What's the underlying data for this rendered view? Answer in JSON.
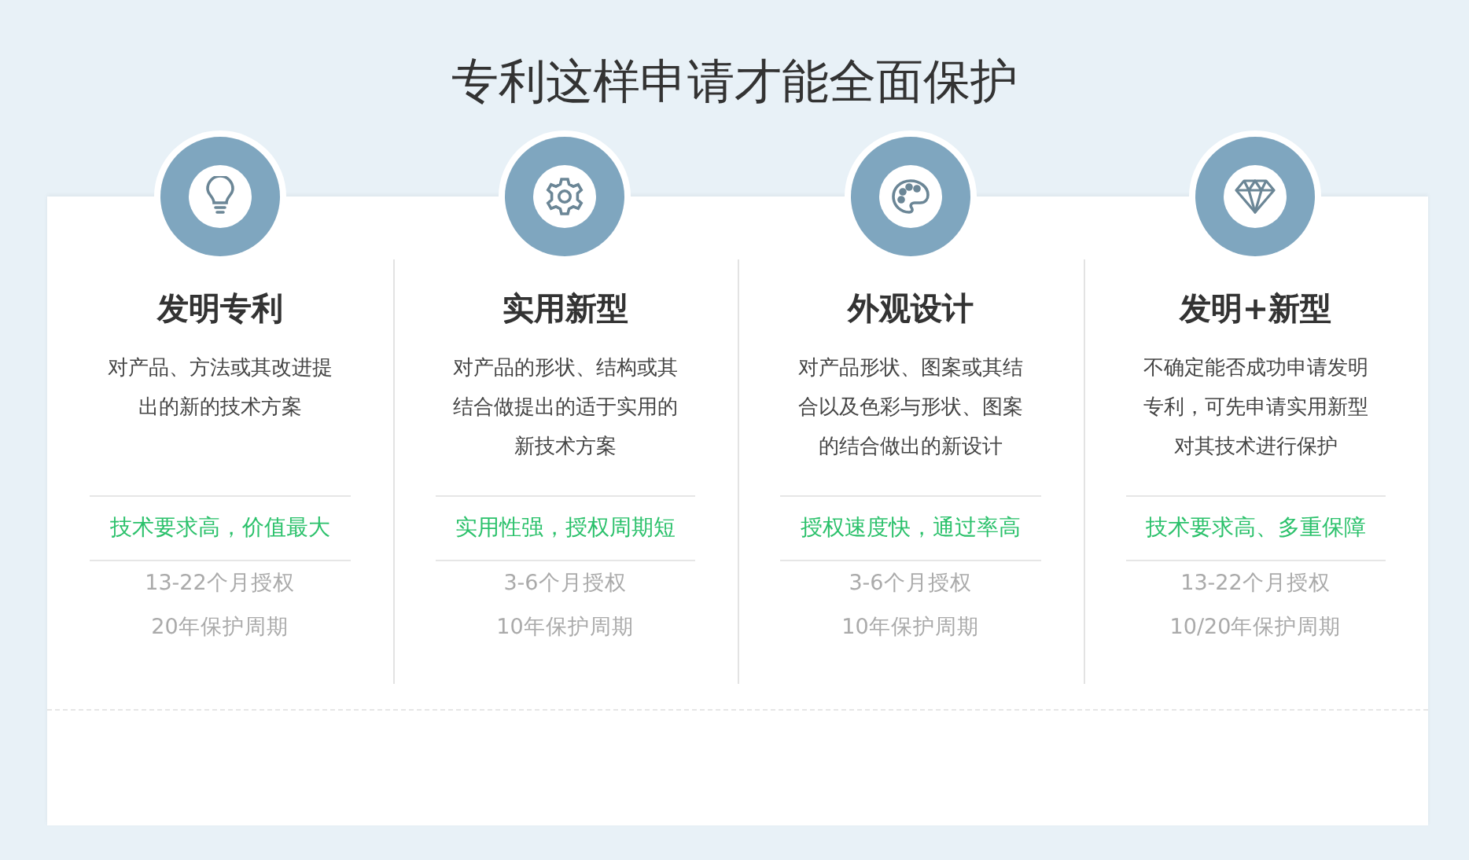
{
  "title": "专利这样申请才能全面保护",
  "plans": [
    {
      "name": "发明专利",
      "description": "对产品、方法或其改进提出的新的技术方案",
      "highlight": "技术要求高，价值最大",
      "grant_time": "13-22个月授权",
      "protection": "20年保护周期"
    },
    {
      "name": "实用新型",
      "description": "对产品的形状、结构或其结合做提出的适于实用的新技术方案",
      "highlight": "实用性强，授权周期短",
      "grant_time": "3-6个月授权",
      "protection": "10年保护周期"
    },
    {
      "name": "外观设计",
      "description": "对产品形状、图案或其结合以及色彩与形状、图案的结合做出的新设计",
      "highlight": "授权速度快，通过率高",
      "grant_time": "3-6个月授权",
      "protection": "10年保护周期"
    },
    {
      "name": "发明+新型",
      "description": "不确定能否成功申请发明专利，可先申请实用新型对其技术进行保护",
      "highlight": "技术要求高、多重保障",
      "grant_time": "13-22个月授权",
      "protection": "10/20年保护周期"
    }
  ]
}
